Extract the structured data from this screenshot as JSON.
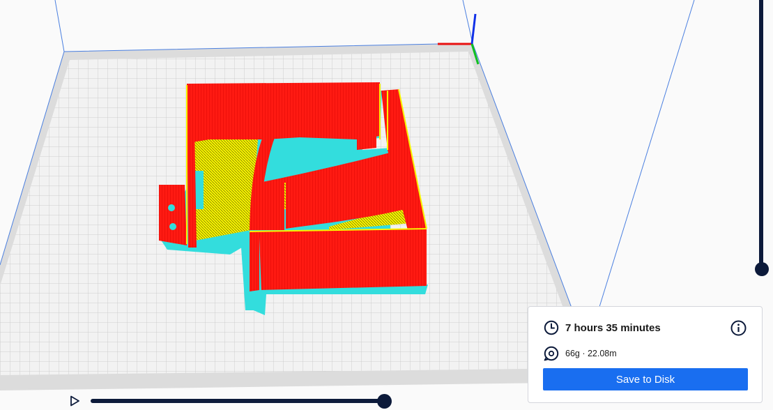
{
  "print_info": {
    "time": "7 hours 35 minutes",
    "material": "66g · 22.08m",
    "save_label": "Save to Disk"
  },
  "icons": {
    "time": "clock-icon",
    "material": "filament-spool-icon",
    "info": "info-icon",
    "play": "play-icon"
  },
  "colors": {
    "accent": "#196ef0",
    "slider": "#0c1a3a",
    "wall_outer": "#ff1a12",
    "wall_inner": "#f8f400",
    "skirt": "#33dddd",
    "axis_x": "#e81010",
    "axis_y": "#10c020",
    "axis_z": "#1030e8"
  },
  "layer_slider": {
    "position": "top"
  },
  "simulation_slider": {
    "position": "end"
  }
}
